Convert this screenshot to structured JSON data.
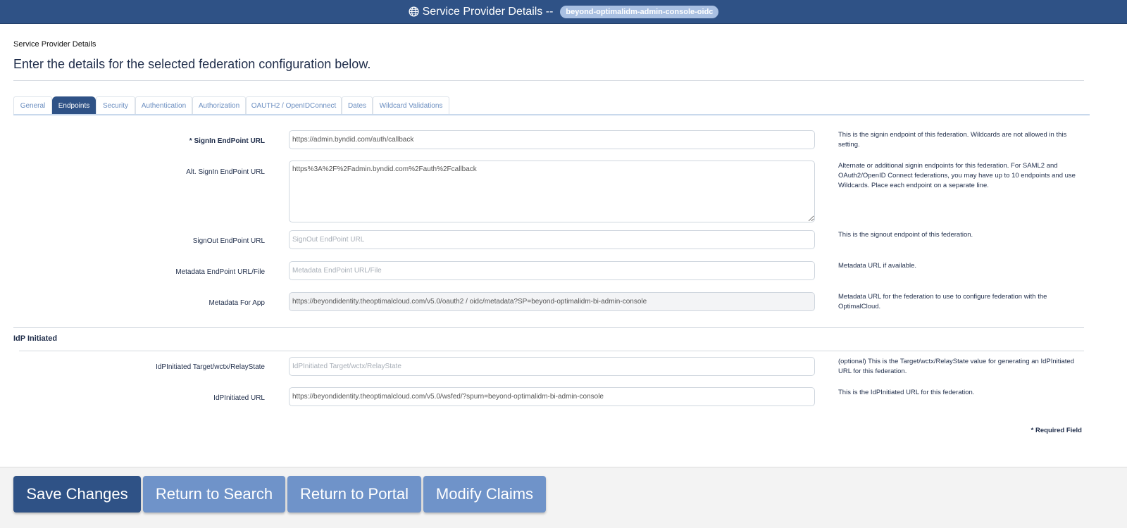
{
  "header": {
    "title": "Service Provider Details --",
    "app_badge": "beyond-optimalidm-admin-console-oidc",
    "icon": "globe-icon"
  },
  "page": {
    "breadcrumb": "Service Provider Details",
    "lead": "Enter the details for the selected federation configuration below."
  },
  "tabs": [
    {
      "label": "General"
    },
    {
      "label": "Endpoints",
      "active": true
    },
    {
      "label": "Security"
    },
    {
      "label": "Authentication"
    },
    {
      "label": "Authorization"
    },
    {
      "label": "OAUTH2 / OpenIDConnect"
    },
    {
      "label": "Dates"
    },
    {
      "label": "Wildcard Validations"
    }
  ],
  "fields": {
    "signin": {
      "label": "* SignIn EndPoint URL",
      "value": "https://admin.byndid.com/auth/callback",
      "help": "This is the signin endpoint of this federation. Wildcards are not allowed in this setting."
    },
    "alt_signin": {
      "label": "Alt. SignIn EndPoint URL",
      "value": "https%3A%2F%2Fadmin.byndid.com%2Fauth%2Fcallback",
      "help": "Alternate or additional signin endpoints for this federation. For SAML2 and OAuth2/OpenID Connect federations, you may have up to 10 endpoints and use Wildcards. Place each endpoint on a separate line."
    },
    "signout": {
      "label": "SignOut EndPoint URL",
      "placeholder": "SignOut EndPoint URL",
      "value": "",
      "help": "This is the signout endpoint of this federation."
    },
    "metadata_endpoint": {
      "label": "Metadata EndPoint URL/File",
      "placeholder": "Metadata EndPoint URL/File",
      "value": "",
      "help": "Metadata URL if available."
    },
    "metadata_app": {
      "label": "Metadata For App",
      "value": "https://beyondidentity.theoptimalcloud.com/v5.0/oauth2 / oidc/metadata?SP=beyond-optimalidm-bi-admin-console",
      "help": "Metadata URL for the federation to use to configure federation with the OptimalCloud."
    }
  },
  "idp_section": {
    "title": "IdP Initiated",
    "target": {
      "label": "IdPInitiated Target/wctx/RelayState",
      "placeholder": "IdPInitiated Target/wctx/RelayState",
      "value": "",
      "help": "(optional) This is the Target/wctx/RelayState value for generating an IdPInitiated URL for this federation."
    },
    "url": {
      "label": "IdPInitiated URL",
      "value": "https://beyondidentity.theoptimalcloud.com/v5.0/wsfed/?spurn=beyond-optimalidm-bi-admin-console",
      "help": "This is the IdPInitiated URL for this federation."
    }
  },
  "required_note": "* Required Field",
  "buttons": {
    "save": "Save Changes",
    "return_search": "Return to Search",
    "return_portal": "Return to Portal",
    "modify_claims": "Modify Claims"
  },
  "colors": {
    "primary": "#2f5286",
    "secondary": "#6f93c9",
    "badge": "#a9c0e2"
  }
}
